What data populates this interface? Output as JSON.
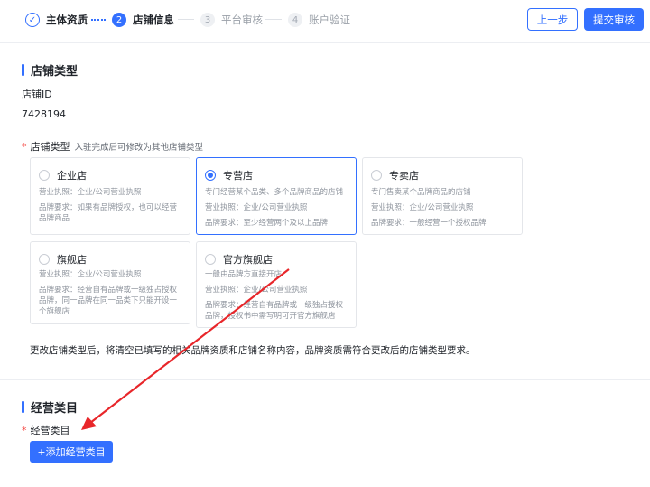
{
  "steps": [
    {
      "label": "主体资质",
      "num": "✓"
    },
    {
      "label": "店铺信息",
      "num": "2"
    },
    {
      "label": "平台审核",
      "num": "3"
    },
    {
      "label": "账户验证",
      "num": "4"
    }
  ],
  "header": {
    "prev_label": "上一步",
    "submit_label": "提交审核"
  },
  "store_section": {
    "title": "店铺类型",
    "store_id_label": "店铺ID",
    "store_id_value": "7428194",
    "type_label": "店铺类型",
    "type_hint": "入驻完成后可修改为其他店铺类型",
    "required_mark": "*"
  },
  "cards": [
    {
      "title": "企业店",
      "lines": [
        "营业执照：企业/公司营业执照",
        "品牌要求：如果有品牌授权，也可以经营",
        "品牌商品"
      ]
    },
    {
      "title": "专营店",
      "lines": [
        "专门经营某个品类、多个品牌商品的店铺",
        "营业执照：企业/公司营业执照",
        "品牌要求：至少经营两个及以上品牌"
      ]
    },
    {
      "title": "专卖店",
      "lines": [
        "专门售卖某个品牌商品的店铺",
        "营业执照：企业/公司营业执照",
        "品牌要求：一般经营一个授权品牌"
      ]
    },
    {
      "title": "旗舰店",
      "lines": [
        "营业执照：企业/公司营业执照",
        "品牌要求：经营自有品牌或一级独占授权",
        "品牌，同一品牌在同一品类下只能开设一",
        "个旗舰店"
      ]
    },
    {
      "title": "官方旗舰店",
      "lines": [
        "一般由品牌方直接开店",
        "营业执照：企业/公司营业执照",
        "品牌要求：经营自有品牌或一级独占授权",
        "品牌，授权书中需写明可开官方旗舰店"
      ]
    }
  ],
  "notice": "更改店铺类型后，将清空已填写的相关品牌资质和店铺名称内容，品牌资质需符合更改后的店铺类型要求。",
  "category_section": {
    "title": "经营类目",
    "field_label": "经营类目",
    "add_button": "+添加经营类目"
  },
  "colors": {
    "accent": "#3370ff",
    "required": "#f54a45",
    "annotation_arrow": "#e8262a"
  }
}
